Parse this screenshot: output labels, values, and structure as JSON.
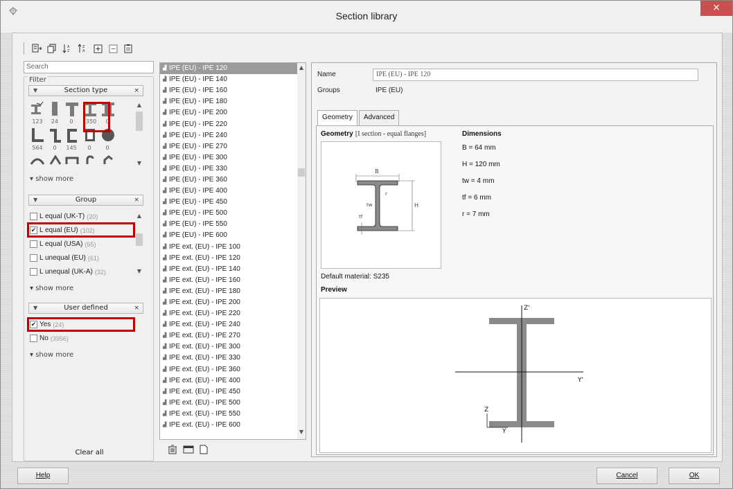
{
  "window": {
    "title": "Section library",
    "close_glyph": "×"
  },
  "toolbar": {
    "icons": [
      "add-section-icon",
      "copy-icon",
      "sort-ascending-icon",
      "sort-descending-icon",
      "expand-all-icon",
      "collapse-all-icon",
      "clipboard-icon"
    ]
  },
  "search": {
    "placeholder": "Search"
  },
  "filter": {
    "label": "Filter",
    "section_type": {
      "header": "Section type",
      "close": "×",
      "row1_counts": [
        "123",
        "24",
        "0",
        "1350",
        "0"
      ],
      "row2_counts": [
        "564",
        "0",
        "145",
        "0",
        "0"
      ],
      "show_more": "show more"
    },
    "group": {
      "header": "Group",
      "close": "×",
      "items": [
        {
          "label": "L equal (UK-T)",
          "count": "(20)",
          "checked": false,
          "check": ""
        },
        {
          "label": "L equal (EU)",
          "count": "(102)",
          "checked": true,
          "check": "✔"
        },
        {
          "label": "L equal (USA)",
          "count": "(65)",
          "checked": false,
          "check": ""
        },
        {
          "label": "L unequal (EU)",
          "count": "(61)",
          "checked": false,
          "check": ""
        },
        {
          "label": "L unequal (UK-A)",
          "count": "(32)",
          "checked": false,
          "check": ""
        }
      ],
      "show_more": "show more"
    },
    "user_defined": {
      "header": "User defined",
      "close": "×",
      "items": [
        {
          "label": "Yes",
          "count": "(24)",
          "checked": true,
          "check": "✔"
        },
        {
          "label": "No",
          "count": "(3956)",
          "checked": false,
          "check": ""
        }
      ],
      "show_more": "show more"
    },
    "clear_all": "Clear all"
  },
  "section_list": [
    "IPE (EU) - IPE 120",
    "IPE (EU) - IPE 140",
    "IPE (EU) - IPE 160",
    "IPE (EU) - IPE 180",
    "IPE (EU) - IPE 200",
    "IPE (EU) - IPE 220",
    "IPE (EU) - IPE 240",
    "IPE (EU) - IPE 270",
    "IPE (EU) - IPE 300",
    "IPE (EU) - IPE 330",
    "IPE (EU) - IPE 360",
    "IPE (EU) - IPE 400",
    "IPE (EU) - IPE 450",
    "IPE (EU) - IPE 500",
    "IPE (EU) - IPE 550",
    "IPE (EU) - IPE 600",
    "IPE ext. (EU) - IPE 100",
    "IPE ext. (EU) - IPE 120",
    "IPE ext. (EU) - IPE 140",
    "IPE ext. (EU) - IPE 160",
    "IPE ext. (EU) - IPE 180",
    "IPE ext. (EU) - IPE 200",
    "IPE ext. (EU) - IPE 220",
    "IPE ext. (EU) - IPE 240",
    "IPE ext. (EU) - IPE 270",
    "IPE ext. (EU) - IPE 300",
    "IPE ext. (EU) - IPE 330",
    "IPE ext. (EU) - IPE 360",
    "IPE ext. (EU) - IPE 400",
    "IPE ext. (EU) - IPE 450",
    "IPE ext. (EU) - IPE 500",
    "IPE ext. (EU) - IPE 550",
    "IPE ext. (EU) - IPE 600"
  ],
  "selected_index": 0,
  "list_buttons": {
    "icons": [
      "delete-icon",
      "rename-icon",
      "new-icon"
    ]
  },
  "detail": {
    "name_label": "Name",
    "name_value": "IPE (EU) - IPE 120",
    "groups_label": "Groups",
    "groups_value": "IPE (EU)",
    "tabs": [
      "Geometry",
      "Advanced"
    ],
    "geometry_title": "Geometry",
    "geometry_subtitle": "[I section - equal flanges]",
    "dimensions_title": "Dimensions",
    "dimensions": [
      "B = 64 mm",
      "H = 120 mm",
      "tw = 4 mm",
      "tf = 6 mm",
      "r = 7 mm"
    ],
    "sketch_labels": {
      "b": "B",
      "h": "H",
      "tw": "tw",
      "tf": "tf",
      "r": "r"
    },
    "default_material": "Default material: S235",
    "preview_title": "Preview",
    "preview_axes": {
      "z_top": "Z'",
      "y_right": "Y'",
      "z": "Z",
      "y": "Y"
    }
  },
  "buttons": {
    "help": "Help",
    "cancel": "Cancel",
    "ok": "OK"
  },
  "colors": {
    "highlight": "#c00000",
    "section_fill": "#8a8a8a",
    "selected_row": "#9b9b9b"
  }
}
